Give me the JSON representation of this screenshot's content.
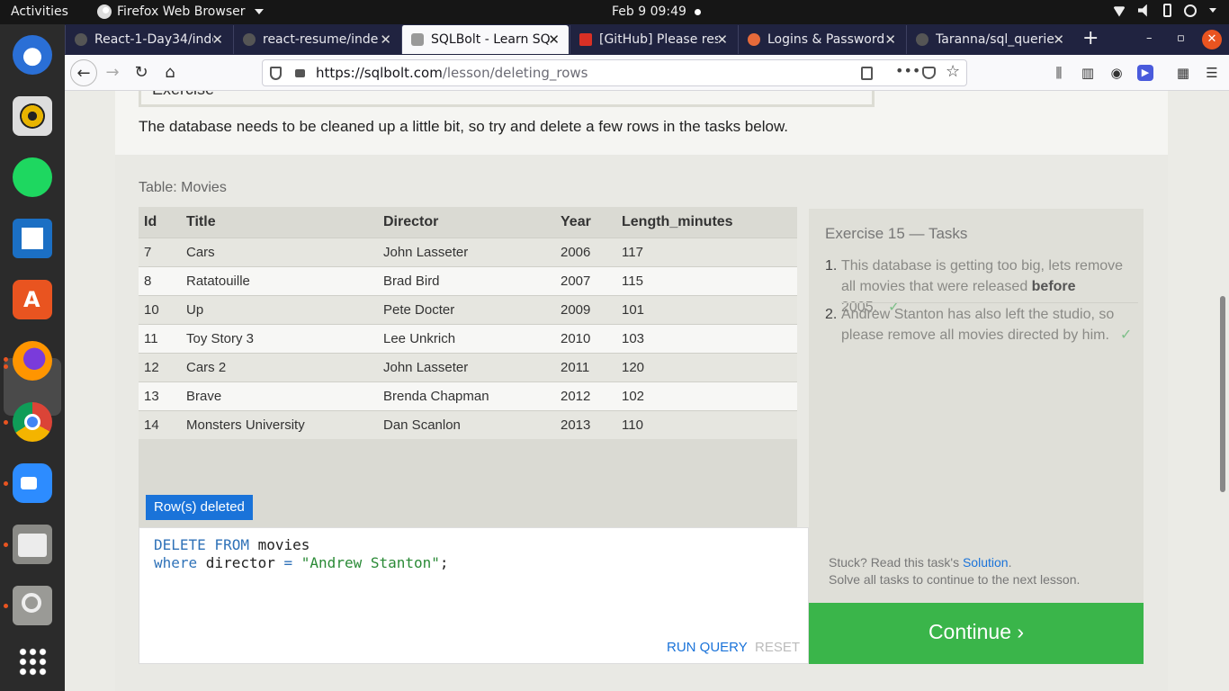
{
  "topbar": {
    "activities": "Activities",
    "app_name": "Firefox Web Browser",
    "clock": "Feb 9  09:49"
  },
  "dock": {
    "items": [
      "thunderbird-icon",
      "rhythmbox-icon",
      "spotify-icon",
      "libreoffice-writer-icon",
      "software-center-icon",
      "firefox-icon",
      "chrome-icon",
      "zoom-icon",
      "files-icon",
      "screenshot-icon",
      "apps-grid-icon"
    ],
    "colors": {
      "background": "#2b2b2b",
      "running_dot": "#e95420"
    }
  },
  "browser": {
    "tabs": [
      {
        "label": "React-1-Day34/inde",
        "favicon": "github-icon",
        "active": false
      },
      {
        "label": "react-resume/inde",
        "favicon": "github-icon",
        "active": false
      },
      {
        "label": "SQLBolt - Learn SQ",
        "favicon": "database-icon",
        "active": true
      },
      {
        "label": "[GitHub] Please res",
        "favicon": "gmail-icon",
        "active": false
      },
      {
        "label": "Logins & Password",
        "favicon": "lockwise-icon",
        "active": false
      },
      {
        "label": "Taranna/sql_querie",
        "favicon": "github-icon",
        "active": false
      }
    ],
    "url_host": "https://sqlbolt.com",
    "url_path": "/lesson/deleting_rows",
    "colors": {
      "tabstrip": "#202340",
      "toolbar": "#f9f9fb"
    }
  },
  "page": {
    "prev_heading": "Exercise",
    "intro": "The database needs to be cleaned up a little bit, so try and delete a few rows in the tasks below.",
    "table_caption": "Table: Movies",
    "table": {
      "columns": [
        "Id",
        "Title",
        "Director",
        "Year",
        "Length_minutes"
      ],
      "rows": [
        [
          "7",
          "Cars",
          "John Lasseter",
          "2006",
          "117"
        ],
        [
          "8",
          "Ratatouille",
          "Brad Bird",
          "2007",
          "115"
        ],
        [
          "10",
          "Up",
          "Pete Docter",
          "2009",
          "101"
        ],
        [
          "11",
          "Toy Story 3",
          "Lee Unkrich",
          "2010",
          "103"
        ],
        [
          "12",
          "Cars 2",
          "John Lasseter",
          "2011",
          "120"
        ],
        [
          "13",
          "Brave",
          "Brenda Chapman",
          "2012",
          "102"
        ],
        [
          "14",
          "Monsters University",
          "Dan Scanlon",
          "2013",
          "110"
        ]
      ]
    },
    "status_badge": "Row(s) deleted",
    "query": {
      "line1_kw": "DELETE FROM",
      "line1_rest": " movies",
      "line2_kw": "where",
      "line2_mid": " director ",
      "line2_op": "=",
      "line2_str": "\"Andrew Stanton\"",
      "line2_end": ";"
    },
    "run_label": "RUN QUERY",
    "reset_label": "RESET",
    "tasks": {
      "title": "Exercise 15 — Tasks",
      "items": [
        {
          "num": "1.",
          "pre": "This database is getting too big, lets remove all movies that were released ",
          "bold": "before",
          "post": " 2005.",
          "check": "✓"
        },
        {
          "num": "2.",
          "pre": "Andrew Stanton has also left the studio, so please remove all movies directed by him.",
          "bold": "",
          "post": "",
          "check": "✓"
        }
      ],
      "stuck_pre": "Stuck? Read this task's ",
      "stuck_link": "Solution",
      "stuck_post": ".",
      "solve_all": "Solve all tasks to continue to the next lesson."
    },
    "continue_label": "Continue ›",
    "colors": {
      "accent_blue": "#1a73d9",
      "continue_green": "#3ab54a"
    }
  }
}
